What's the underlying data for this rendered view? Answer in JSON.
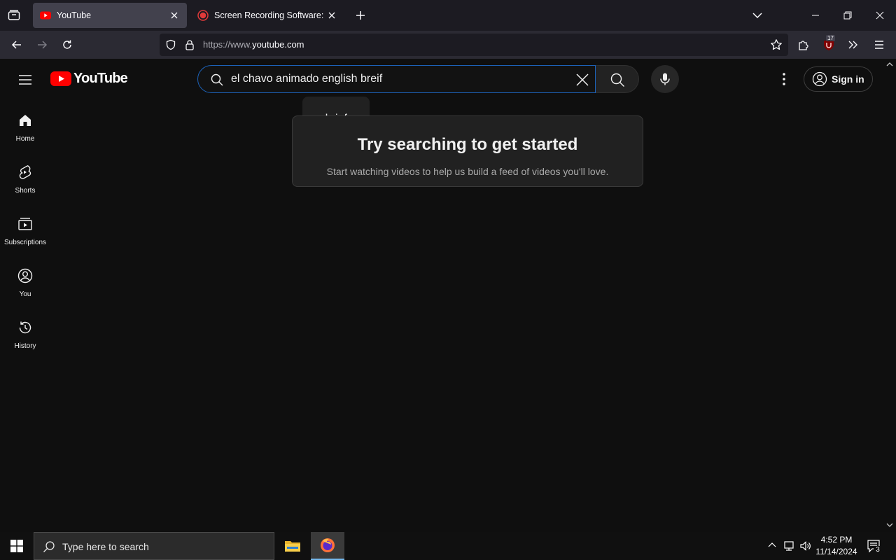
{
  "browser": {
    "tabs": [
      {
        "title": "YouTube",
        "active": true
      },
      {
        "title": "Screen Recording Software: capture your screen",
        "active": false
      }
    ],
    "url_prefix": "https://www.",
    "url_domain": "youtube.com",
    "extension_badge": "17"
  },
  "youtube": {
    "logo_text": "YouTube",
    "search": {
      "query": "el chavo animado english breif"
    },
    "signin_label": "Sign in",
    "guide": [
      {
        "label": "Home",
        "icon": "home-icon"
      },
      {
        "label": "Shorts",
        "icon": "shorts-icon"
      },
      {
        "label": "Subscriptions",
        "icon": "subscriptions-icon"
      },
      {
        "label": "You",
        "icon": "you-icon"
      },
      {
        "label": "History",
        "icon": "history-icon"
      }
    ],
    "tooltip": "... brief",
    "empty_state": {
      "title": "Try searching to get started",
      "subtitle": "Start watching videos to help us build a feed of videos you'll love."
    }
  },
  "taskbar": {
    "search_placeholder": "Type here to search",
    "time": "4:52 PM",
    "date": "11/14/2024",
    "notification_count": "3"
  },
  "colors": {
    "yt_red": "#ff0000",
    "search_focus": "#1c62b9",
    "background": "#0f0f0f"
  }
}
